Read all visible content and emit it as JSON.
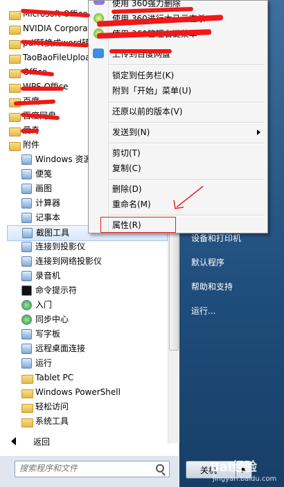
{
  "programs": [
    {
      "label": "Microsoft Office",
      "icon": "folder-icon",
      "indent": 0,
      "redacted": true
    },
    {
      "label": "NVIDIA Corporation",
      "icon": "folder-icon",
      "indent": 0,
      "redacted": false
    },
    {
      "label": "pdf转换成word转换器",
      "icon": "folder-icon",
      "indent": 0,
      "redacted": true
    },
    {
      "label": "TaoBaoFileUpload",
      "icon": "folder-icon",
      "indent": 0,
      "redacted": false
    },
    {
      "label": "Office",
      "icon": "folder-icon",
      "indent": 0,
      "redacted": true
    },
    {
      "label": "WPS Office",
      "icon": "folder-icon",
      "indent": 0,
      "redacted": true
    },
    {
      "label": "百度",
      "icon": "folder-icon",
      "indent": 0,
      "redacted": true
    },
    {
      "label": "百度网盘",
      "icon": "folder-icon",
      "indent": 0,
      "redacted": true
    },
    {
      "label": "爱奇",
      "icon": "folder-icon",
      "indent": 0,
      "redacted": true
    },
    {
      "label": "附件",
      "icon": "folder-icon",
      "indent": 0,
      "redacted": false
    },
    {
      "label": "Windows 资源管理器",
      "icon": "explorer-icon",
      "indent": 1,
      "redacted": false
    },
    {
      "label": "便笺",
      "icon": "sticky-notes-icon",
      "indent": 1,
      "redacted": false
    },
    {
      "label": "画图",
      "icon": "paint-icon",
      "indent": 1,
      "redacted": false
    },
    {
      "label": "计算器",
      "icon": "calculator-icon",
      "indent": 1,
      "redacted": false
    },
    {
      "label": "记事本",
      "icon": "notepad-icon",
      "indent": 1,
      "redacted": false
    },
    {
      "label": "截图工具",
      "icon": "snipping-tool-icon",
      "indent": 1,
      "redacted": false,
      "selected": true
    },
    {
      "label": "连接到投影仪",
      "icon": "projector-icon",
      "indent": 1,
      "redacted": false
    },
    {
      "label": "连接到网络投影仪",
      "icon": "network-projector-icon",
      "indent": 1,
      "redacted": false
    },
    {
      "label": "录音机",
      "icon": "microphone-icon",
      "indent": 1,
      "redacted": false
    },
    {
      "label": "命令提示符",
      "icon": "cmd-icon",
      "indent": 1,
      "redacted": false
    },
    {
      "label": "入门",
      "icon": "getting-started-icon",
      "indent": 1,
      "redacted": false
    },
    {
      "label": "同步中心",
      "icon": "sync-icon",
      "indent": 1,
      "redacted": false
    },
    {
      "label": "写字板",
      "icon": "wordpad-icon",
      "indent": 1,
      "redacted": false
    },
    {
      "label": "远程桌面连接",
      "icon": "remote-desktop-icon",
      "indent": 1,
      "redacted": false
    },
    {
      "label": "运行",
      "icon": "run-icon",
      "indent": 1,
      "redacted": false
    },
    {
      "label": "Tablet PC",
      "icon": "folder-icon",
      "indent": 1,
      "redacted": false
    },
    {
      "label": "Windows PowerShell",
      "icon": "folder-icon",
      "indent": 1,
      "redacted": false
    },
    {
      "label": "轻松访问",
      "icon": "folder-icon",
      "indent": 1,
      "redacted": false
    },
    {
      "label": "系统工具",
      "icon": "folder-icon",
      "indent": 1,
      "redacted": false
    }
  ],
  "back_label": "返回",
  "search_placeholder": "搜索程序和文件",
  "right_links": [
    "设备和打印机",
    "默认程序",
    "帮助和支持",
    "运行..."
  ],
  "shutdown_label": "关机",
  "context_menu": {
    "top_items": [
      "使用 360强力删除",
      "使用 360进行木马云查杀",
      "使用 360管理右键菜单",
      "上传到百度网盘"
    ],
    "g1": [
      "锁定到任务栏(K)",
      "附到「开始」菜单(U)"
    ],
    "g2": [
      "还原以前的版本(V)"
    ],
    "g3": [
      "发送到(N)"
    ],
    "g4": [
      "剪切(T)",
      "复制(C)"
    ],
    "g5": [
      "删除(D)",
      "重命名(M)"
    ],
    "g6": [
      "属性(R)"
    ]
  },
  "watermark": "Bai经验",
  "watermark_url": "jingyan.baidu.com",
  "colors": {
    "annotation_red": "#e82020",
    "start_blue": "#1f4d7c"
  }
}
